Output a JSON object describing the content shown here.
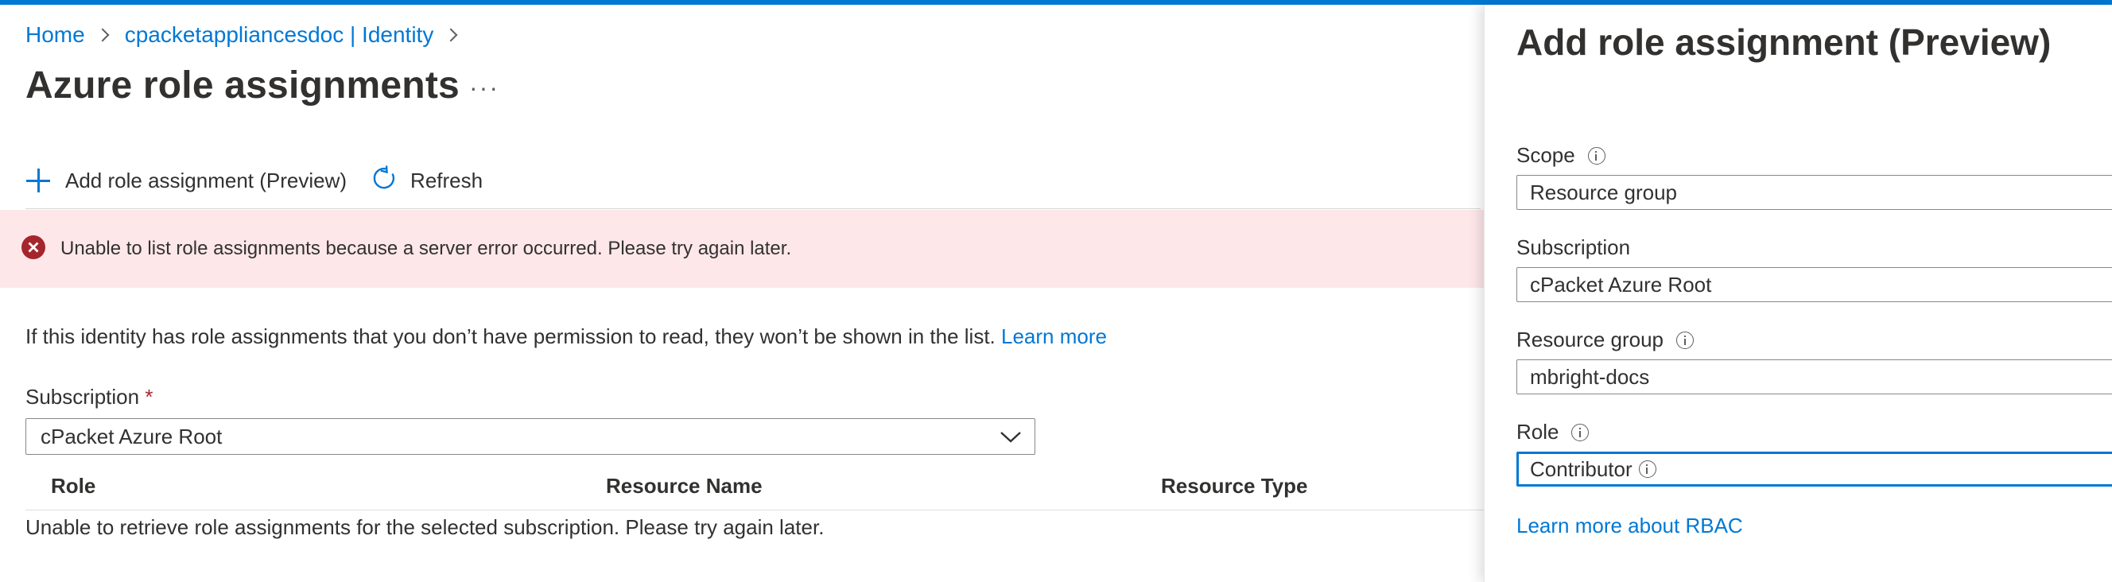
{
  "breadcrumb": {
    "home": "Home",
    "identity": "cpacketappliancesdoc | Identity"
  },
  "page": {
    "title": "Azure role assignments",
    "more_label": "···"
  },
  "toolbar": {
    "add_label": "Add role assignment (Preview)",
    "refresh_label": "Refresh"
  },
  "error": {
    "message": "Unable to list role assignments because a server error occurred. Please try again later."
  },
  "info": {
    "text": "If this identity has role assignments that you don’t have permission to read, they won’t be shown in the list.",
    "link": "Learn more"
  },
  "subscription": {
    "label": "Subscription",
    "required_mark": "*",
    "value": "cPacket Azure Root"
  },
  "grid": {
    "columns": [
      "Role",
      "Resource Name",
      "Resource Type"
    ],
    "empty_message": "Unable to retrieve role assignments for the selected subscription. Please try again later."
  },
  "panel": {
    "title": "Add role assignment (Preview)",
    "scope": {
      "label": "Scope",
      "value": "Resource group"
    },
    "subscription": {
      "label": "Subscription",
      "value": "cPacket Azure Root"
    },
    "resource_group": {
      "label": "Resource group",
      "value": "mbright-docs"
    },
    "role": {
      "label": "Role",
      "value": "Contributor"
    },
    "rbac_link": "Learn more about RBAC"
  },
  "colors": {
    "accent": "#0078d4",
    "error_bg": "#fde7e9",
    "error_icon": "#a4262c"
  },
  "icons": [
    "chevron-right-icon",
    "more-icon",
    "plus-icon",
    "refresh-icon",
    "error-icon",
    "chevron-down-icon",
    "info-icon"
  ]
}
